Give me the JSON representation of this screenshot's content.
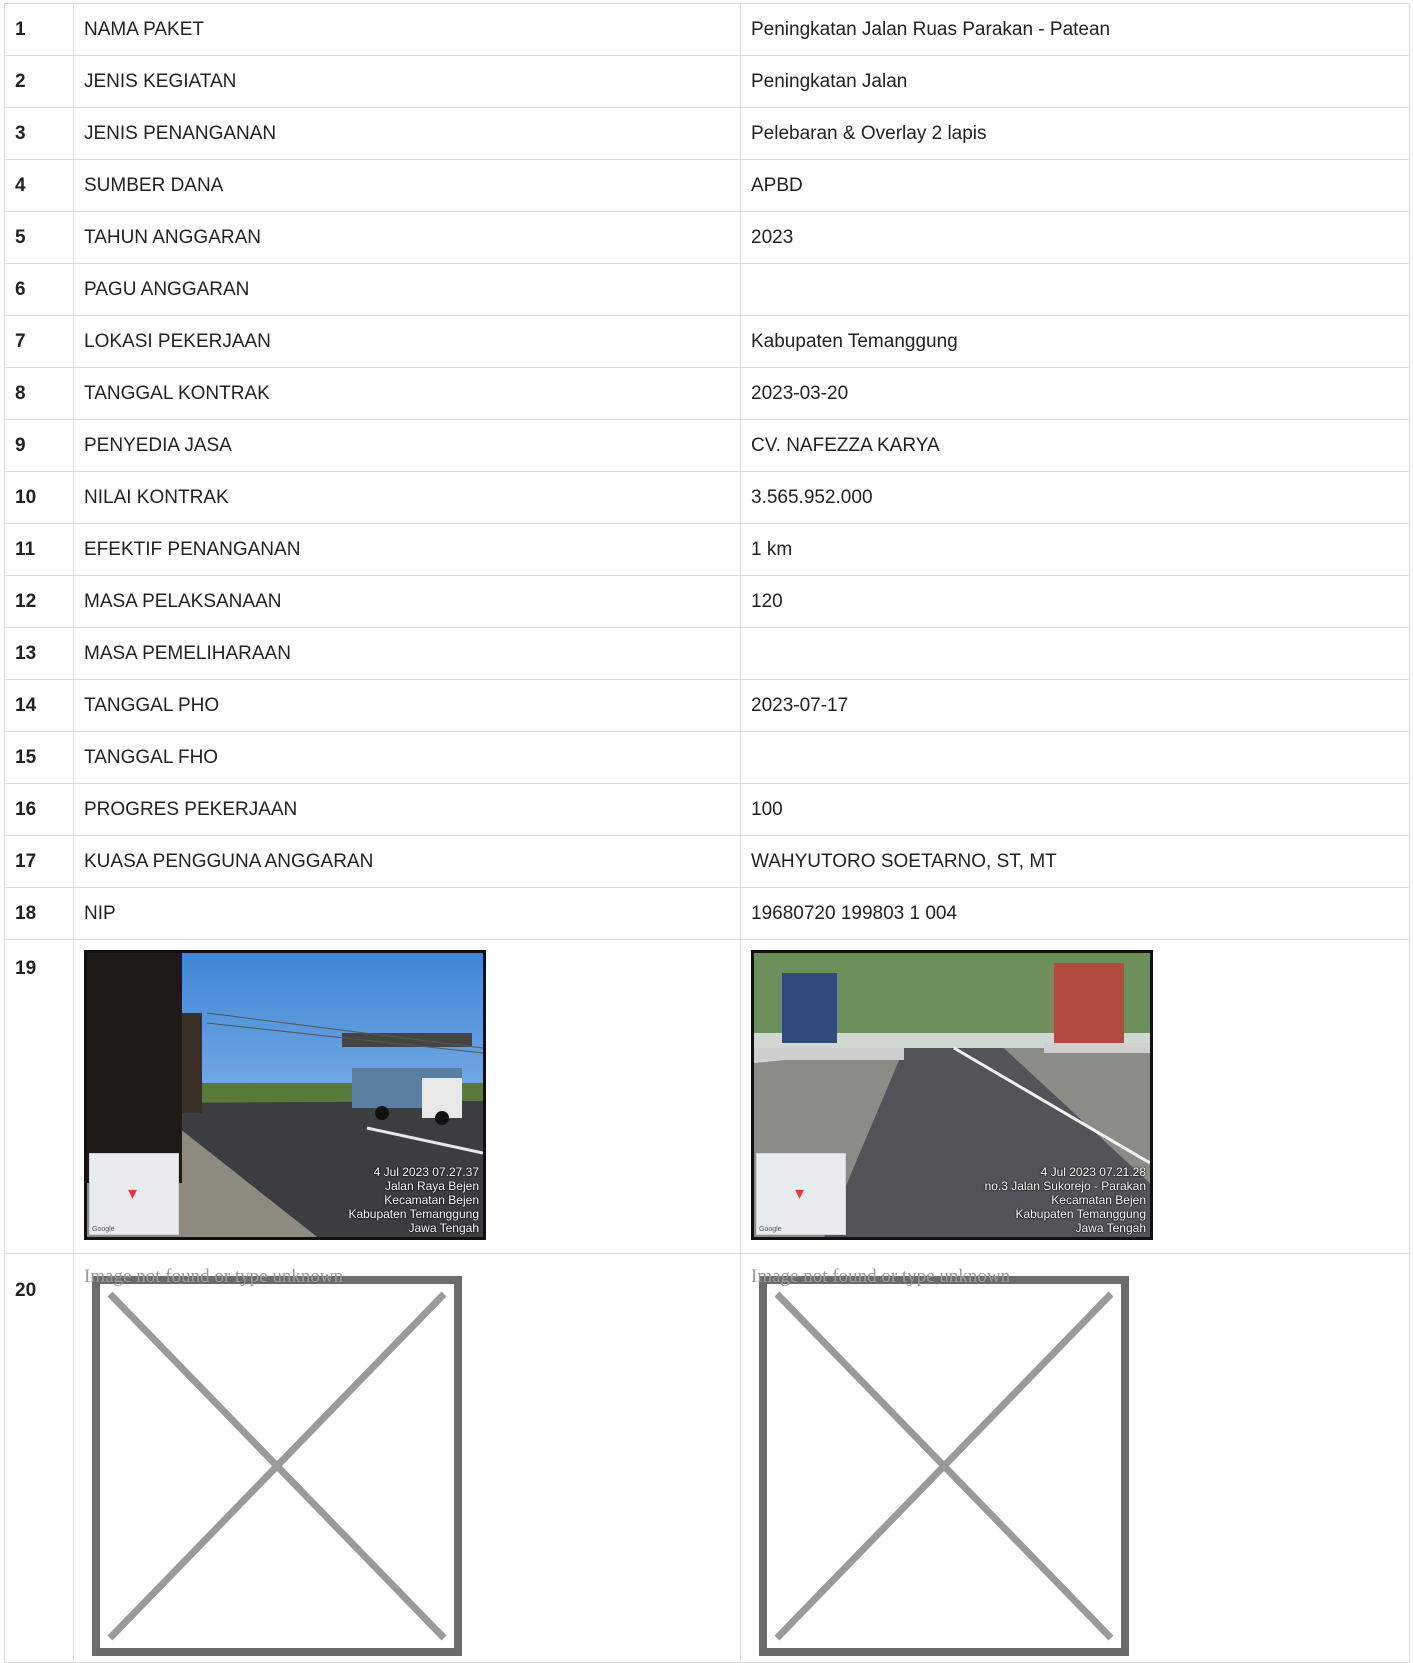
{
  "rows": [
    {
      "no": "1",
      "label": "NAMA PAKET",
      "value": "Peningkatan Jalan Ruas Parakan - Patean"
    },
    {
      "no": "2",
      "label": "JENIS KEGIATAN",
      "value": "Peningkatan Jalan"
    },
    {
      "no": "3",
      "label": "JENIS PENANGANAN",
      "value": "Pelebaran & Overlay 2 lapis"
    },
    {
      "no": "4",
      "label": "SUMBER DANA",
      "value": "APBD"
    },
    {
      "no": "5",
      "label": "TAHUN ANGGARAN",
      "value": "2023"
    },
    {
      "no": "6",
      "label": "PAGU ANGGARAN",
      "value": ""
    },
    {
      "no": "7",
      "label": "LOKASI PEKERJAAN",
      "value": "Kabupaten Temanggung"
    },
    {
      "no": "8",
      "label": "TANGGAL KONTRAK",
      "value": "2023-03-20"
    },
    {
      "no": "9",
      "label": "PENYEDIA JASA",
      "value": "CV. NAFEZZA KARYA"
    },
    {
      "no": "10",
      "label": "NILAI KONTRAK",
      "value": "3.565.952.000"
    },
    {
      "no": "11",
      "label": "EFEKTIF PENANGANAN",
      "value": "1 km"
    },
    {
      "no": "12",
      "label": "MASA PELAKSANAAN",
      "value": "120"
    },
    {
      "no": "13",
      "label": "MASA PEMELIHARAAN",
      "value": ""
    },
    {
      "no": "14",
      "label": "TANGGAL PHO",
      "value": "2023-07-17"
    },
    {
      "no": "15",
      "label": "TANGGAL FHO",
      "value": ""
    },
    {
      "no": "16",
      "label": "PROGRES PEKERJAAN",
      "value": "100"
    },
    {
      "no": "17",
      "label": "KUASA PENGGUNA ANGGARAN",
      "value": "WAHYUTORO SOETARNO, ST, MT"
    },
    {
      "no": "18",
      "label": "NIP",
      "value": "19680720 199803 1 004"
    }
  ],
  "photo_row": {
    "no": "19",
    "left": {
      "stamp": [
        "4 Jul 2023 07.27.37",
        "Jalan Raya Bejen",
        "Kecamatan Bejen",
        "Kabupaten Temanggung",
        "Jawa Tengah"
      ]
    },
    "right": {
      "stamp": [
        "4 Jul 2023 07.21.28",
        "no.3 Jalan Sukorejo - Parakan",
        "Kecamatan Bejen",
        "Kabupaten Temanggung",
        "Jawa Tengah"
      ]
    },
    "map_credit": "Google"
  },
  "broken_row": {
    "no": "20",
    "alt_text": "Image not found or type unknown"
  },
  "colors": {
    "border": "#dcdcdc",
    "broken_frame": "#6b6b6b",
    "broken_cross": "#9a9a9a",
    "alt_text": "#9a9a9a"
  }
}
